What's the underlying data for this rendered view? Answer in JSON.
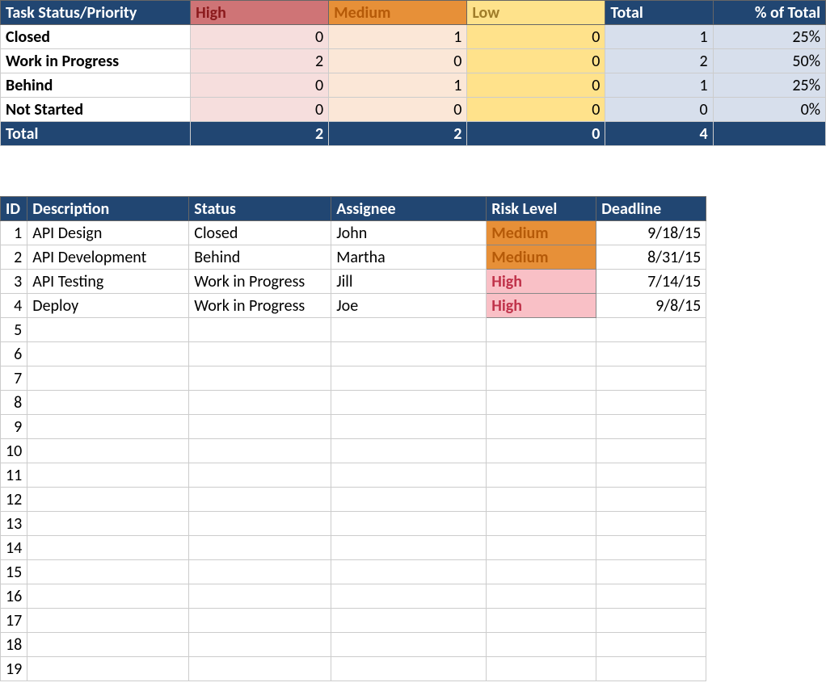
{
  "summary": {
    "header": {
      "label": "Task Status/Priority",
      "high": "High",
      "medium": "Medium",
      "low": "Low",
      "total": "Total",
      "pct": "% of Total"
    },
    "rows": [
      {
        "label": "Closed",
        "high": "0",
        "medium": "1",
        "low": "0",
        "total": "1",
        "pct": "25%"
      },
      {
        "label": "Work in Progress",
        "high": "2",
        "medium": "0",
        "low": "0",
        "total": "2",
        "pct": "50%"
      },
      {
        "label": "Behind",
        "high": "0",
        "medium": "1",
        "low": "0",
        "total": "1",
        "pct": "25%"
      },
      {
        "label": "Not Started",
        "high": "0",
        "medium": "0",
        "low": "0",
        "total": "0",
        "pct": "0%"
      }
    ],
    "footer": {
      "label": "Total",
      "high": "2",
      "medium": "2",
      "low": "0",
      "total": "4",
      "pct": ""
    }
  },
  "tasks": {
    "header": {
      "id": "ID",
      "description": "Description",
      "status": "Status",
      "assignee": "Assignee",
      "risk": "Risk Level",
      "deadline": "Deadline"
    },
    "rows": [
      {
        "id": "1",
        "description": "API Design",
        "status": "Closed",
        "assignee": "John",
        "risk": "Medium",
        "risk_class": "risk-medium",
        "deadline": "9/18/15"
      },
      {
        "id": "2",
        "description": "API Development",
        "status": "Behind",
        "assignee": "Martha",
        "risk": "Medium",
        "risk_class": "risk-medium",
        "deadline": "8/31/15"
      },
      {
        "id": "3",
        "description": "API Testing",
        "status": "Work in Progress",
        "assignee": "Jill",
        "risk": "High",
        "risk_class": "risk-high",
        "deadline": "7/14/15"
      },
      {
        "id": "4",
        "description": "Deploy",
        "status": "Work in Progress",
        "assignee": "Joe",
        "risk": "High",
        "risk_class": "risk-high",
        "deadline": "9/8/15"
      }
    ],
    "empty_row_ids": [
      "5",
      "6",
      "7",
      "8",
      "9",
      "10",
      "11",
      "12",
      "13",
      "14",
      "15",
      "16",
      "17",
      "18",
      "19"
    ]
  },
  "chart_data": {
    "type": "table",
    "title": "Task Status/Priority",
    "categories": [
      "High",
      "Medium",
      "Low",
      "Total",
      "% of Total"
    ],
    "rows": [
      {
        "label": "Closed",
        "High": 0,
        "Medium": 1,
        "Low": 0,
        "Total": 1,
        "% of Total": "25%"
      },
      {
        "label": "Work in Progress",
        "High": 2,
        "Medium": 0,
        "Low": 0,
        "Total": 2,
        "% of Total": "50%"
      },
      {
        "label": "Behind",
        "High": 0,
        "Medium": 1,
        "Low": 0,
        "Total": 1,
        "% of Total": "25%"
      },
      {
        "label": "Not Started",
        "High": 0,
        "Medium": 0,
        "Low": 0,
        "Total": 0,
        "% of Total": "0%"
      },
      {
        "label": "Total",
        "High": 2,
        "Medium": 2,
        "Low": 0,
        "Total": 4,
        "% of Total": ""
      }
    ]
  }
}
